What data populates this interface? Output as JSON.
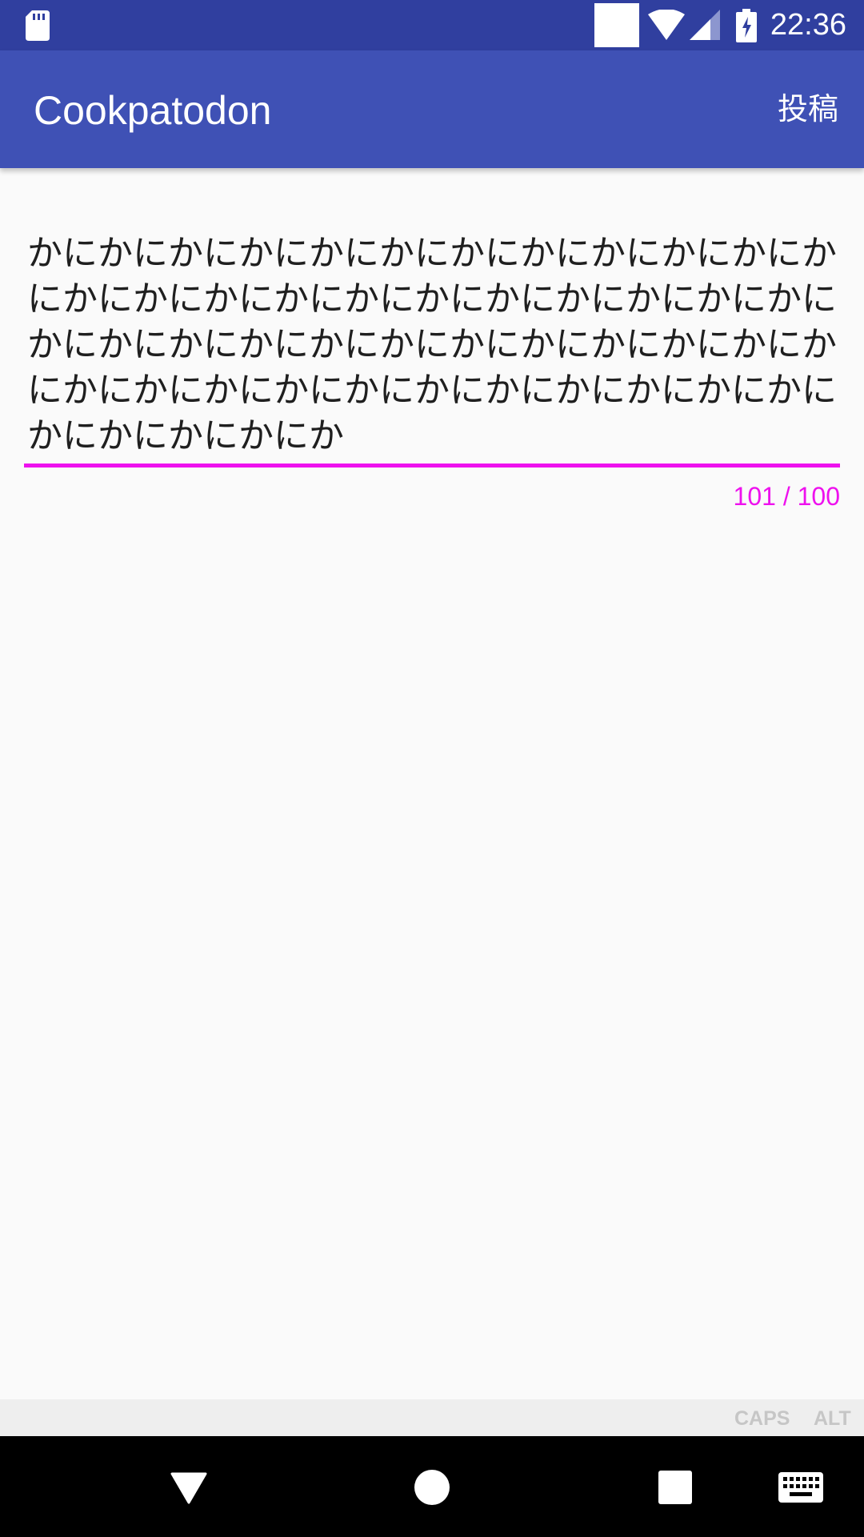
{
  "status_bar": {
    "time": "22:36",
    "icons": [
      "sd-card-icon",
      "white-square-icon",
      "wifi-icon",
      "cell-signal-icon",
      "battery-charging-icon"
    ]
  },
  "toolbar": {
    "title": "Cookpatodon",
    "post_label": "投稿",
    "color": "#3f51b5"
  },
  "compose": {
    "text": "かにかにかにかにかにかにかにかにかにかにかにかにかにかにかにかにかにかにかにかにかにかにかにかにかにかにかにかにかにかにかにかにかにかにかにかにかにかにかにかにかにかにかにかにかにかにかにかにかにかにか",
    "counter": "101 / 100",
    "error_color": "#ee11ee"
  },
  "keyboard_strip": {
    "caps_label": "CAPS",
    "alt_label": "ALT"
  },
  "nav_bar": {
    "icons": [
      "back-icon",
      "home-icon",
      "recents-icon",
      "keyboard-icon"
    ]
  }
}
